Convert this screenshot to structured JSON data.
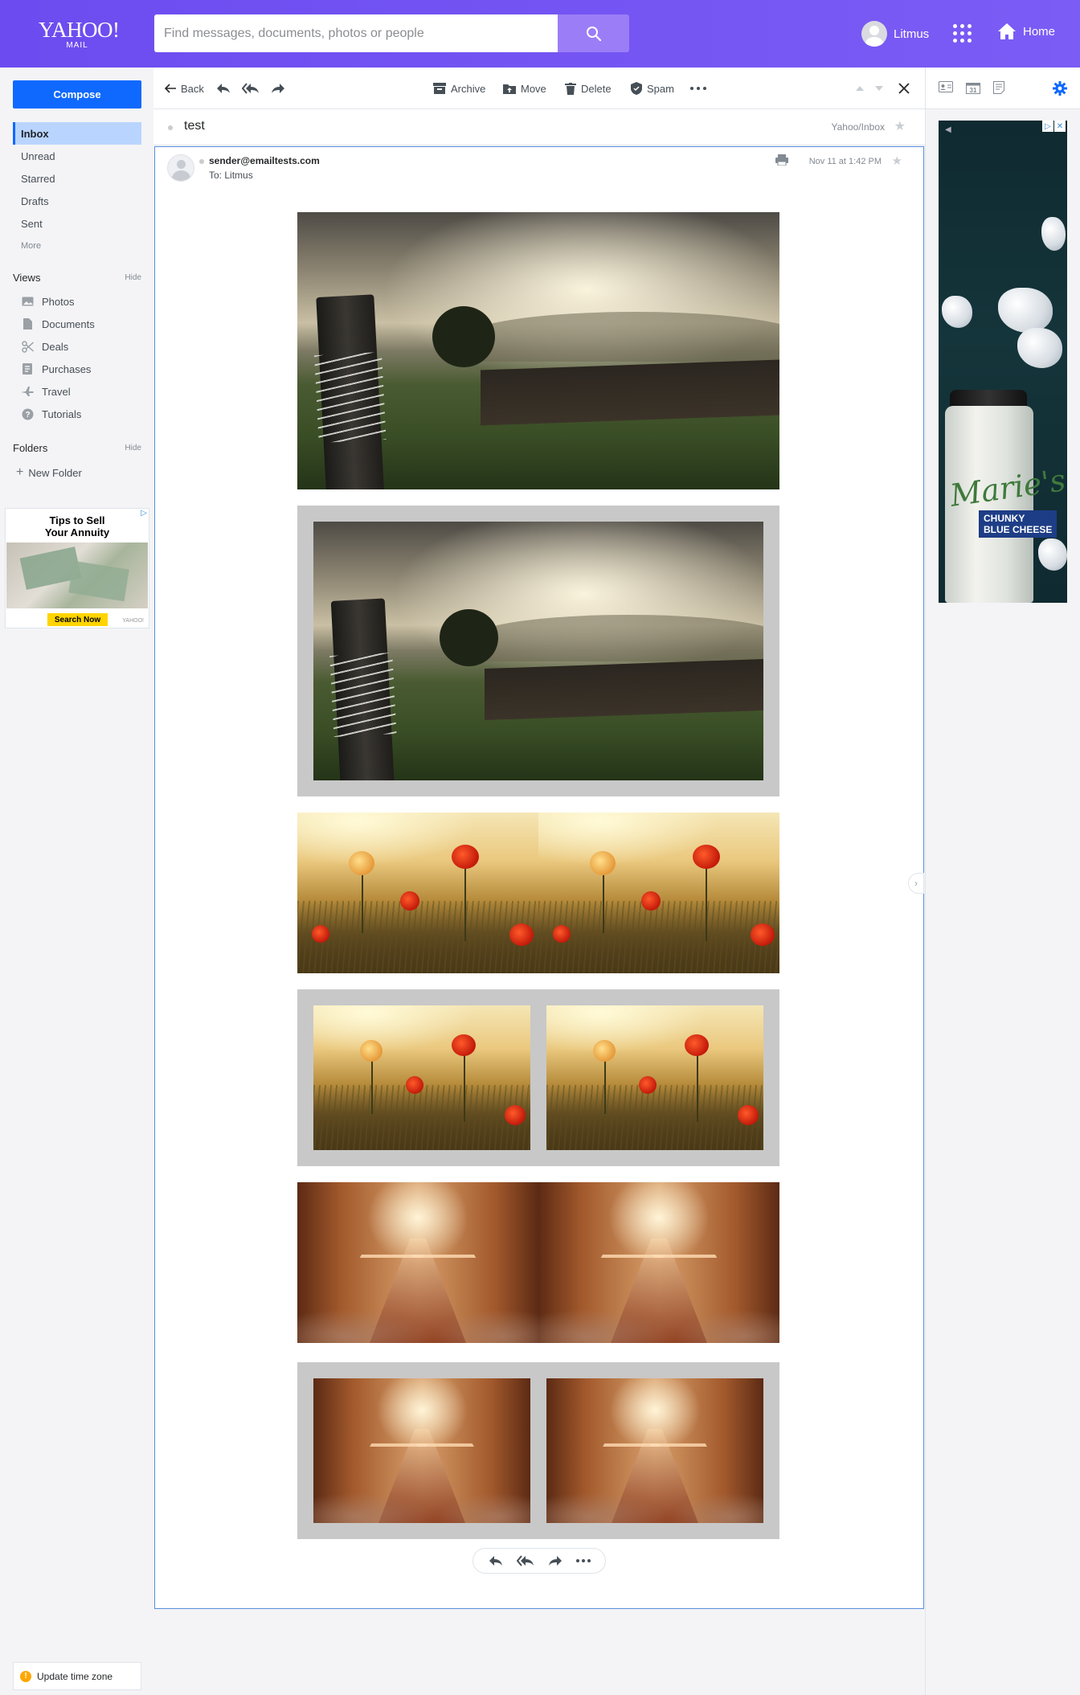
{
  "header": {
    "logo_line1": "YAHOO!",
    "logo_line2": "MAIL",
    "search_placeholder": "Find messages, documents, photos or people",
    "user_name": "Litmus",
    "home_label": "Home"
  },
  "sidebar": {
    "compose": "Compose",
    "items": [
      {
        "label": "Inbox"
      },
      {
        "label": "Unread"
      },
      {
        "label": "Starred"
      },
      {
        "label": "Drafts"
      },
      {
        "label": "Sent"
      },
      {
        "label": "More"
      }
    ],
    "views_title": "Views",
    "views_hide": "Hide",
    "views": [
      {
        "label": "Photos",
        "icon": "photos-icon"
      },
      {
        "label": "Documents",
        "icon": "documents-icon"
      },
      {
        "label": "Deals",
        "icon": "scissors-icon"
      },
      {
        "label": "Purchases",
        "icon": "receipt-icon"
      },
      {
        "label": "Travel",
        "icon": "airplane-icon"
      },
      {
        "label": "Tutorials",
        "icon": "help-icon"
      }
    ],
    "folders_title": "Folders",
    "folders_hide": "Hide",
    "new_folder": "New Folder",
    "ad": {
      "title_line1": "Tips to Sell",
      "title_line2": "Your Annuity",
      "button": "Search Now",
      "brand": "YAHOO!"
    },
    "timezone": "Update time zone"
  },
  "toolbar": {
    "back": "Back",
    "archive": "Archive",
    "move": "Move",
    "delete": "Delete",
    "spam": "Spam"
  },
  "message": {
    "subject": "test",
    "folder_path": "Yahoo/Inbox",
    "from": "sender@emailtests.com",
    "to_label": "To:",
    "to": "Litmus",
    "date": "Nov 11 at 1:42 PM"
  },
  "right_ad": {
    "brand": "Marie's",
    "label_line1": "CHUNKY",
    "label_line2": "BLUE CHEESE"
  },
  "colors": {
    "header_bg": "#6c4cf0",
    "accent": "#0f69ff",
    "inbox_highlight": "#b9d5ff"
  }
}
